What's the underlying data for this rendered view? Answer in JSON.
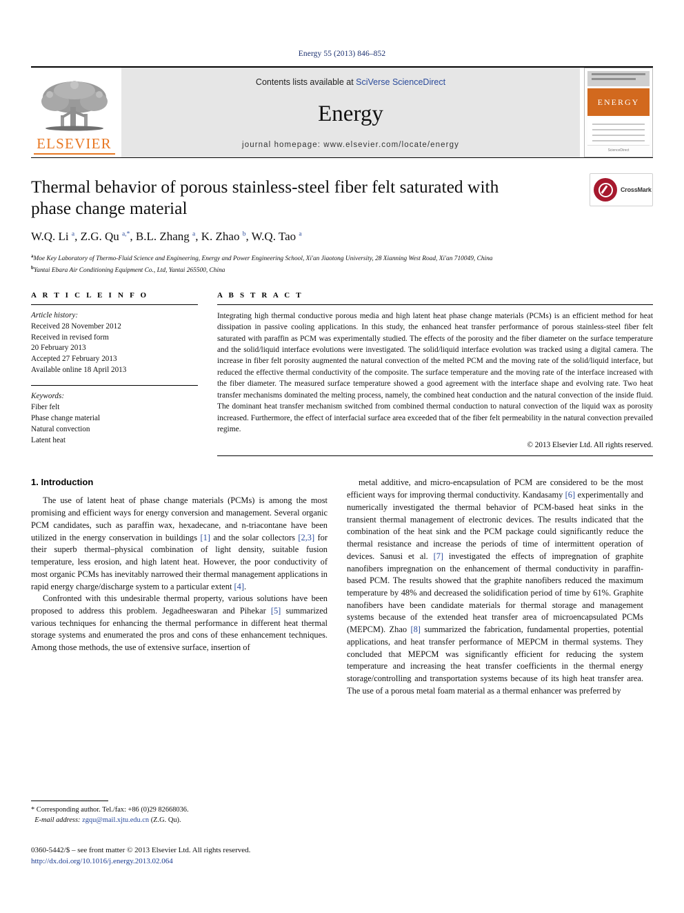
{
  "running_head": "Energy 55 (2013) 846–852",
  "masthead": {
    "publisher_name": "ELSEVIER",
    "contents_prefix": "Contents lists available at ",
    "contents_link": "SciVerse ScienceDirect",
    "journal_name": "Energy",
    "homepage": "journal homepage: www.elsevier.com/locate/energy",
    "cover_title": "ENERGY",
    "cover_footer": "ScienceDirect"
  },
  "crossmark": {
    "label": "CrossMark"
  },
  "article": {
    "title": "Thermal behavior of porous stainless-steel fiber felt saturated with phase change material",
    "authors_html": "W.Q. Li <sup>a</sup>, Z.G. Qu <sup>a,*</sup>, B.L. Zhang <sup>a</sup>, K. Zhao <sup>b</sup>, W.Q. Tao <sup>a</sup>",
    "affiliation_a": "Moe Key Laboratory of Thermo-Fluid Science and Engineering, Energy and Power Engineering School, Xi'an Jiaotong University, 28 Xianning West Road, Xi'an 710049, China",
    "affiliation_b": "Yantai Ebara Air Conditioning Equipment Co., Ltd, Yantai 265500, China"
  },
  "article_info": {
    "heading": "A R T I C L E   I N F O",
    "history_label": "Article history:",
    "history": [
      "Received 28 November 2012",
      "Received in revised form",
      "20 February 2013",
      "Accepted 27 February 2013",
      "Available online 18 April 2013"
    ],
    "keywords_label": "Keywords:",
    "keywords": [
      "Fiber felt",
      "Phase change material",
      "Natural convection",
      "Latent heat"
    ]
  },
  "abstract": {
    "heading": "A B S T R A C T",
    "text": "Integrating high thermal conductive porous media and high latent heat phase change materials (PCMs) is an efficient method for heat dissipation in passive cooling applications. In this study, the enhanced heat transfer performance of porous stainless-steel fiber felt saturated with paraffin as PCM was experimentally studied. The effects of the porosity and the fiber diameter on the surface temperature and the solid/liquid interface evolutions were investigated. The solid/liquid interface evolution was tracked using a digital camera. The increase in fiber felt porosity augmented the natural convection of the melted PCM and the moving rate of the solid/liquid interface, but reduced the effective thermal conductivity of the composite. The surface temperature and the moving rate of the interface increased with the fiber diameter. The measured surface temperature showed a good agreement with the interface shape and evolving rate. Two heat transfer mechanisms dominated the melting process, namely, the combined heat conduction and the natural convection of the inside fluid. The dominant heat transfer mechanism switched from combined thermal conduction to natural convection of the liquid wax as porosity increased. Furthermore, the effect of interfacial surface area exceeded that of the fiber felt permeability in the natural convection prevailed regime.",
    "copyright": "© 2013 Elsevier Ltd. All rights reserved."
  },
  "body": {
    "section_title": "1. Introduction",
    "left_paragraphs": [
      "The use of latent heat of phase change materials (PCMs) is among the most promising and efficient ways for energy conversion and management. Several organic PCM candidates, such as paraffin wax, hexadecane, and n-triacontane have been utilized in the energy conservation in buildings [1] and the solar collectors [2,3] for their superb thermal–physical combination of light density, suitable fusion temperature, less erosion, and high latent heat. However, the poor conductivity of most organic PCMs has inevitably narrowed their thermal management applications in rapid energy charge/discharge system to a particular extent [4].",
      "Confronted with this undesirable thermal property, various solutions have been proposed to address this problem. Jegadheeswaran and Pihekar [5] summarized various techniques for enhancing the thermal performance in different heat thermal storage systems and enumerated the pros and cons of these enhancement techniques. Among those methods, the use of extensive surface, insertion of"
    ],
    "right_paragraphs": [
      "metal additive, and micro-encapsulation of PCM are considered to be the most efficient ways for improving thermal conductivity. Kandasamy [6] experimentally and numerically investigated the thermal behavior of PCM-based heat sinks in the transient thermal management of electronic devices. The results indicated that the combination of the heat sink and the PCM package could significantly reduce the thermal resistance and increase the periods of time of intermittent operation of devices. Sanusi et al. [7] investigated the effects of impregnation of graphite nanofibers impregnation on the enhancement of thermal conductivity in paraffin-based PCM. The results showed that the graphite nanofibers reduced the maximum temperature by 48% and decreased the solidification period of time by 61%. Graphite nanofibers have been candidate materials for thermal storage and management systems because of the extended heat transfer area of microencapsulated PCMs (MEPCM). Zhao [8] summarized the fabrication, fundamental properties, potential applications, and heat transfer performance of MEPCM in thermal systems. They concluded that MEPCM was significantly efficient for reducing the system temperature and increasing the heat transfer coefficients in the thermal energy storage/controlling and transportation systems because of its high heat transfer area. The use of a porous metal foam material as a thermal enhancer was preferred by"
    ]
  },
  "footnotes": {
    "corresponding": "* Corresponding author. Tel./fax: +86 (0)29 82668036.",
    "email_label": "E-mail address:",
    "email": "zgqu@mail.xjtu.edu.cn",
    "email_suffix": "(Z.G. Qu)."
  },
  "issn_line": "0360-5442/$ – see front matter © 2013 Elsevier Ltd. All rights reserved.",
  "doi_line": "http://dx.doi.org/10.1016/j.energy.2013.02.064",
  "colors": {
    "link_blue": "#2b4b9b",
    "header_blue": "#1a2f6e",
    "elsevier_orange": "#E87722",
    "crossmark_red": "#a6192e",
    "band_gray": "#e6e6e6"
  }
}
